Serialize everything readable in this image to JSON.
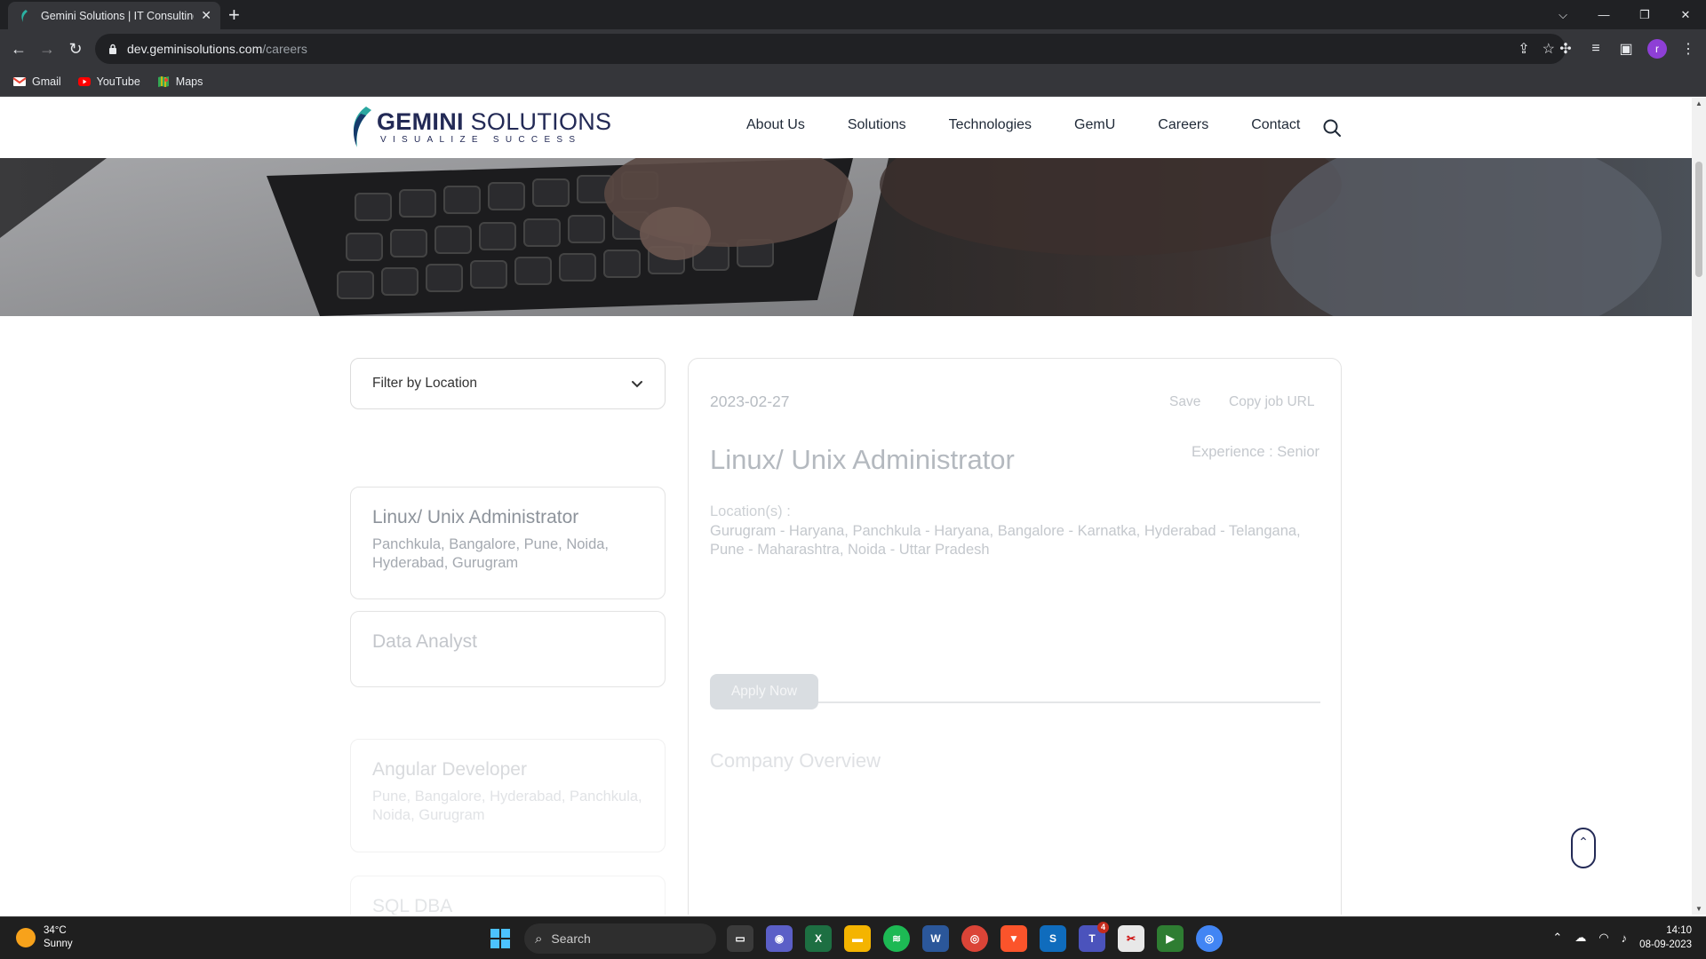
{
  "browser": {
    "tab_title": "Gemini Solutions | IT Consulting,",
    "url_host": "dev.geminisolutions.com",
    "url_path": "/careers",
    "avatar_letter": "r",
    "bookmarks": [
      {
        "label": "Gmail",
        "icon": "gmail-icon"
      },
      {
        "label": "YouTube",
        "icon": "youtube-icon"
      },
      {
        "label": "Maps",
        "icon": "maps-icon"
      }
    ]
  },
  "site": {
    "logo_name_bold": "GEMINI",
    "logo_name_rest": "SOLUTIONS",
    "logo_tagline": "VISUALIZE SUCCESS",
    "nav": [
      "About Us",
      "Solutions",
      "Technologies",
      "GemU",
      "Careers",
      "Contact"
    ]
  },
  "careers": {
    "filter_label": "Filter by Location",
    "jobs": [
      {
        "title": "Linux/ Unix Administrator",
        "locations": "Panchkula, Bangalore, Pune, Noida, Hyderabad, Gurugram"
      },
      {
        "title": "Data Analyst",
        "locations": ""
      },
      {
        "title": "Angular Developer",
        "locations": "Pune, Bangalore, Hyderabad, Panchkula, Noida, Gurugram"
      },
      {
        "title": "SQL DBA",
        "locations": ""
      }
    ],
    "detail": {
      "date": "2023-02-27",
      "save_label": "Save",
      "copy_label": "Copy job URL",
      "title": "Linux/ Unix Administrator",
      "experience": "Experience : Senior",
      "locations_label": "Location(s) :",
      "locations": "Gurugram - Haryana, Panchkula - Haryana, Bangalore - Karnatka, Hyderabad - Telangana, Pune - Maharashtra, Noida - Uttar Pradesh",
      "apply_label": "Apply Now",
      "overview_heading": "Company Overview"
    }
  },
  "taskbar": {
    "temperature": "34°C",
    "condition": "Sunny",
    "search_label": "Search",
    "time": "14:10",
    "date": "08-09-2023",
    "teams_badge": "4"
  }
}
